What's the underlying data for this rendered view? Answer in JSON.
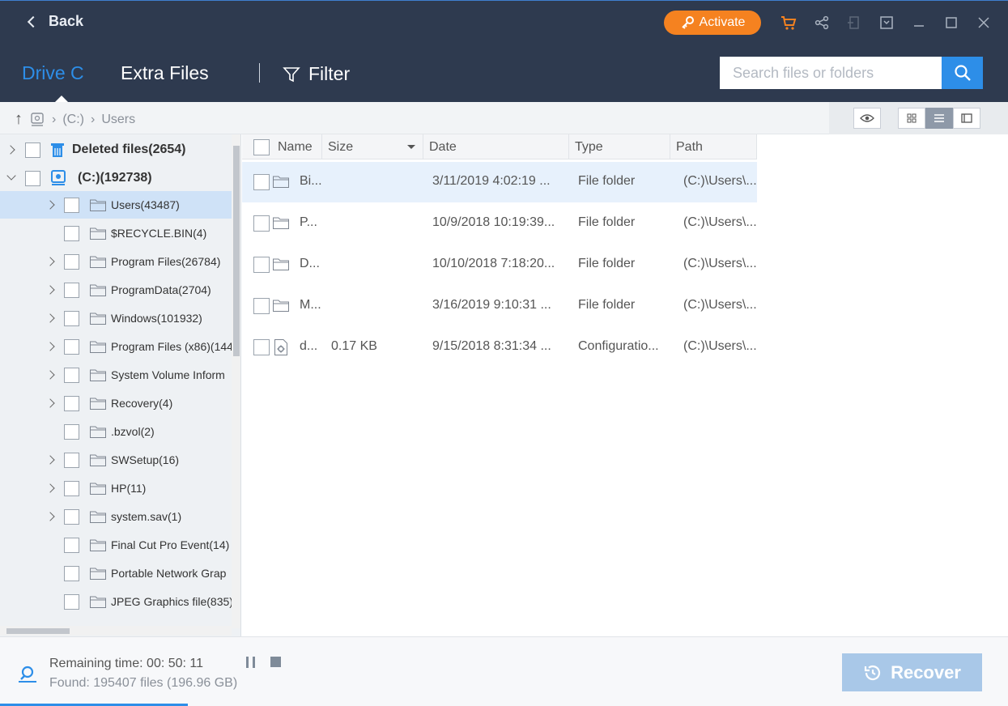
{
  "titlebar": {
    "back_label": "Back",
    "activate_label": "Activate",
    "accent": "#2d8ee8",
    "activate_color": "#f58220",
    "icons": [
      "cart-icon",
      "share-icon",
      "exit-icon",
      "menu-icon",
      "minimize-icon",
      "maximize-icon",
      "close-icon"
    ]
  },
  "tabs": [
    {
      "label": "Drive C",
      "active": true
    },
    {
      "label": "Extra Files",
      "active": false
    }
  ],
  "filter_label": "Filter",
  "search": {
    "placeholder": "Search files or folders"
  },
  "breadcrumb": [
    "(C:)",
    "Users"
  ],
  "tree": [
    {
      "label": "Deleted files(2654)",
      "expand": "right",
      "icon": "trash-icon",
      "root": true
    },
    {
      "label": "(C:)(192738)",
      "expand": "down",
      "icon": "drive-icon",
      "root": true
    },
    {
      "label": "Users(43487)",
      "expand": "right",
      "selected": true
    },
    {
      "label": "$RECYCLE.BIN(4)",
      "expand": "none"
    },
    {
      "label": "Program Files(26784)",
      "expand": "right"
    },
    {
      "label": "ProgramData(2704)",
      "expand": "right"
    },
    {
      "label": "Windows(101932)",
      "expand": "right"
    },
    {
      "label": "Program Files (x86)(144",
      "expand": "right"
    },
    {
      "label": "System Volume Inform",
      "expand": "right"
    },
    {
      "label": "Recovery(4)",
      "expand": "right"
    },
    {
      "label": ".bzvol(2)",
      "expand": "none"
    },
    {
      "label": "SWSetup(16)",
      "expand": "right"
    },
    {
      "label": "HP(11)",
      "expand": "right"
    },
    {
      "label": "system.sav(1)",
      "expand": "right"
    },
    {
      "label": "Final Cut Pro Event(14)",
      "expand": "none"
    },
    {
      "label": "Portable Network Grap",
      "expand": "none"
    },
    {
      "label": "JPEG Graphics file(835)",
      "expand": "none"
    }
  ],
  "columns": [
    "Name",
    "Size",
    "Date",
    "Type",
    "Path"
  ],
  "files": [
    {
      "name": "Bi...",
      "size": "",
      "date": "3/11/2019 4:02:19 ...",
      "type": "File folder",
      "path": "(C:)\\Users\\...",
      "icon": "folder-icon",
      "selected": true
    },
    {
      "name": "P...",
      "size": "",
      "date": "10/9/2018 10:19:39...",
      "type": "File folder",
      "path": "(C:)\\Users\\...",
      "icon": "folder-icon"
    },
    {
      "name": "D...",
      "size": "",
      "date": "10/10/2018 7:18:20...",
      "type": "File folder",
      "path": "(C:)\\Users\\...",
      "icon": "folder-icon"
    },
    {
      "name": "M...",
      "size": "",
      "date": "3/16/2019 9:10:31 ...",
      "type": "File folder",
      "path": "(C:)\\Users\\...",
      "icon": "folder-icon"
    },
    {
      "name": "d...",
      "size": "0.17 KB",
      "date": "9/15/2018 8:31:34 ...",
      "type": "Configuratio...",
      "path": "(C:)\\Users\\...",
      "icon": "config-file-icon"
    }
  ],
  "status": {
    "remaining": "Remaining time: 00: 50: 11",
    "found": "Found: 195407 files (196.96 GB)"
  },
  "recover_label": "Recover"
}
